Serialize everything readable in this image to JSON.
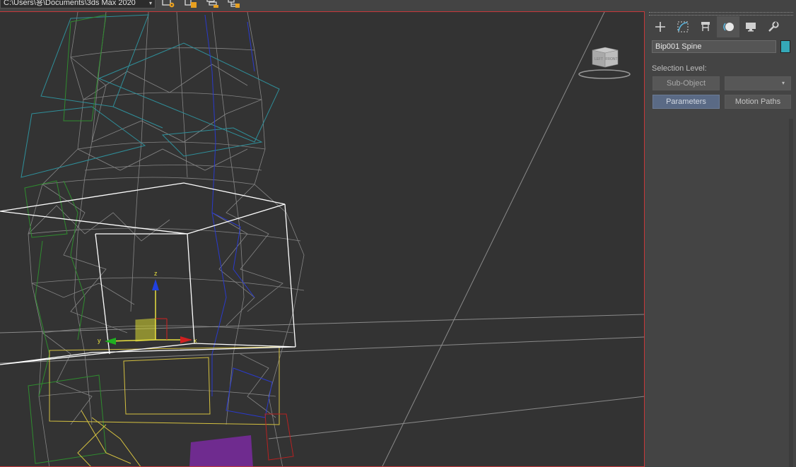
{
  "topbar": {
    "path_text": "C:\\Users\\용\\Documents\\3ds Max 2020",
    "caret": "▾",
    "icons": [
      "project-settings-icon",
      "project-folder-icon",
      "layer-manager-icon",
      "scene-explorer-icon"
    ]
  },
  "viewport": {
    "viewcube_labels": {
      "left": "LEFT",
      "front": "FRONT"
    },
    "gizmo_axes": {
      "x": "x",
      "y": "y",
      "z": "z"
    },
    "colors": {
      "active_border": "#c8383a",
      "wire_gray": "#8e8e8e",
      "selection_white": "#ffffff",
      "axis_x": "#cc2020",
      "axis_y": "#22aa22",
      "axis_z": "#1a3cc8",
      "gizmo_plane": "#e0e040"
    }
  },
  "command_panel": {
    "tabs": [
      {
        "name": "create",
        "icon": "plus-icon"
      },
      {
        "name": "modify",
        "icon": "modify-curve-icon"
      },
      {
        "name": "hierarchy",
        "icon": "hierarchy-icon"
      },
      {
        "name": "motion",
        "icon": "motion-icon",
        "active": true
      },
      {
        "name": "display",
        "icon": "display-monitor-icon"
      },
      {
        "name": "utilities",
        "icon": "wrench-icon"
      }
    ],
    "object_name": "Bip001 Spine",
    "object_color": "#35a8b8",
    "selection_level_label": "Selection Level:",
    "sub_object_label": "Sub-Object",
    "dropdown_value": "",
    "dropdown_caret": "▾",
    "parameters_label": "Parameters",
    "motion_paths_label": "Motion Paths"
  }
}
